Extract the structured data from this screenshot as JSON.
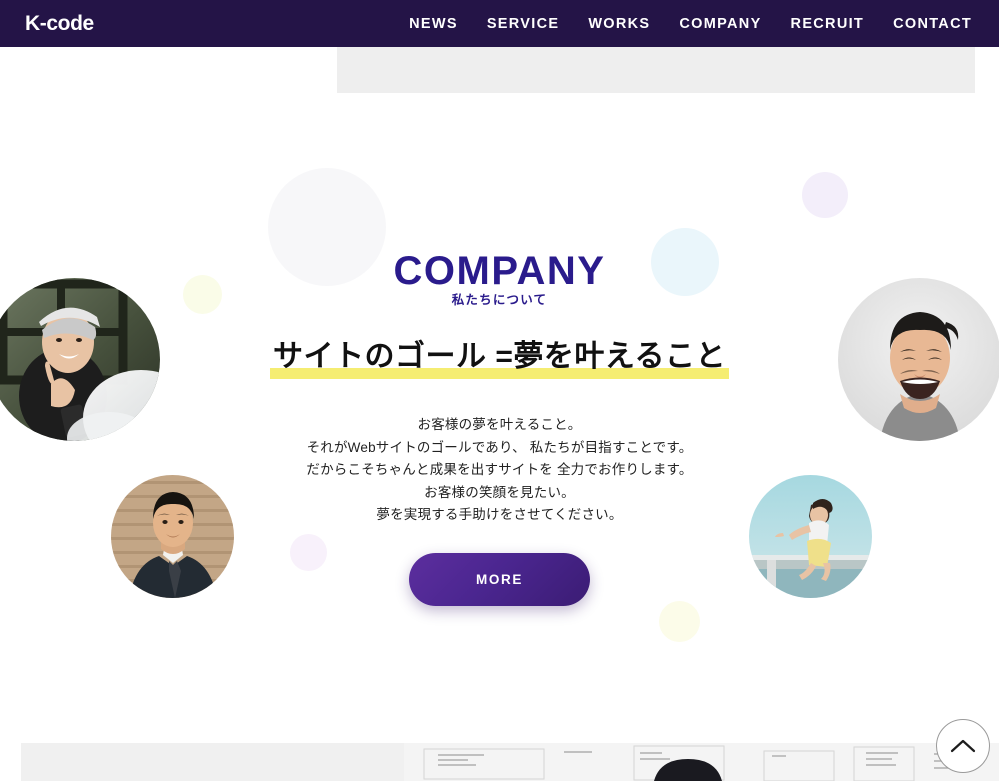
{
  "header": {
    "logo": "K-code",
    "nav": [
      {
        "label": "NEWS"
      },
      {
        "label": "SERVICE"
      },
      {
        "label": "WORKS"
      },
      {
        "label": "COMPANY"
      },
      {
        "label": "RECRUIT"
      },
      {
        "label": "CONTACT"
      }
    ]
  },
  "section": {
    "title": "COMPANY",
    "subtitle": "私たちについて",
    "headline": "サイトのゴール =夢を叶えること",
    "body": [
      "お客様の夢を叶えること。",
      "それがWebサイトのゴールであり、 私たちが目指すことです。",
      "だからこそちゃんと成果を出すサイトを 全力でお作りします。",
      "お客様の笑顔を見たい。",
      "夢を実現する手助けをさせてください。"
    ],
    "more_label": "MORE"
  },
  "photos": [
    {
      "name": "woman-headband-portrait",
      "alt": "Smiling woman with headband holding phone"
    },
    {
      "name": "man-grey-shirt-portrait",
      "alt": "Laughing man in grey t-shirt"
    },
    {
      "name": "man-suit-portrait",
      "alt": "Man in dark suit in front of wood wall"
    },
    {
      "name": "woman-jumping-seaside",
      "alt": "Woman jumping by the sea"
    }
  ],
  "decor_circles": [
    {
      "name": "decor-gray-big",
      "color": "#f7f7f9"
    },
    {
      "name": "decor-blue",
      "color": "#eaf6fb"
    },
    {
      "name": "decor-lavender-top",
      "color": "#f3eefa"
    },
    {
      "name": "decor-yellow-left",
      "color": "#fafce8"
    },
    {
      "name": "decor-lavender-mid",
      "color": "#f8f1fb"
    },
    {
      "name": "decor-yellow-bottom",
      "color": "#fcfce9"
    }
  ],
  "colors": {
    "header_bg": "#241447",
    "brand_indigo": "#2a1b8c",
    "highlight_yellow": "#f5ed72",
    "button_gradient_start": "#5c2e9e",
    "button_gradient_end": "#3b1c74"
  },
  "scroll_top": {
    "icon": "chevron-up-icon"
  },
  "next_section": {
    "photo_alt": "Person looking at whiteboard with notes"
  }
}
